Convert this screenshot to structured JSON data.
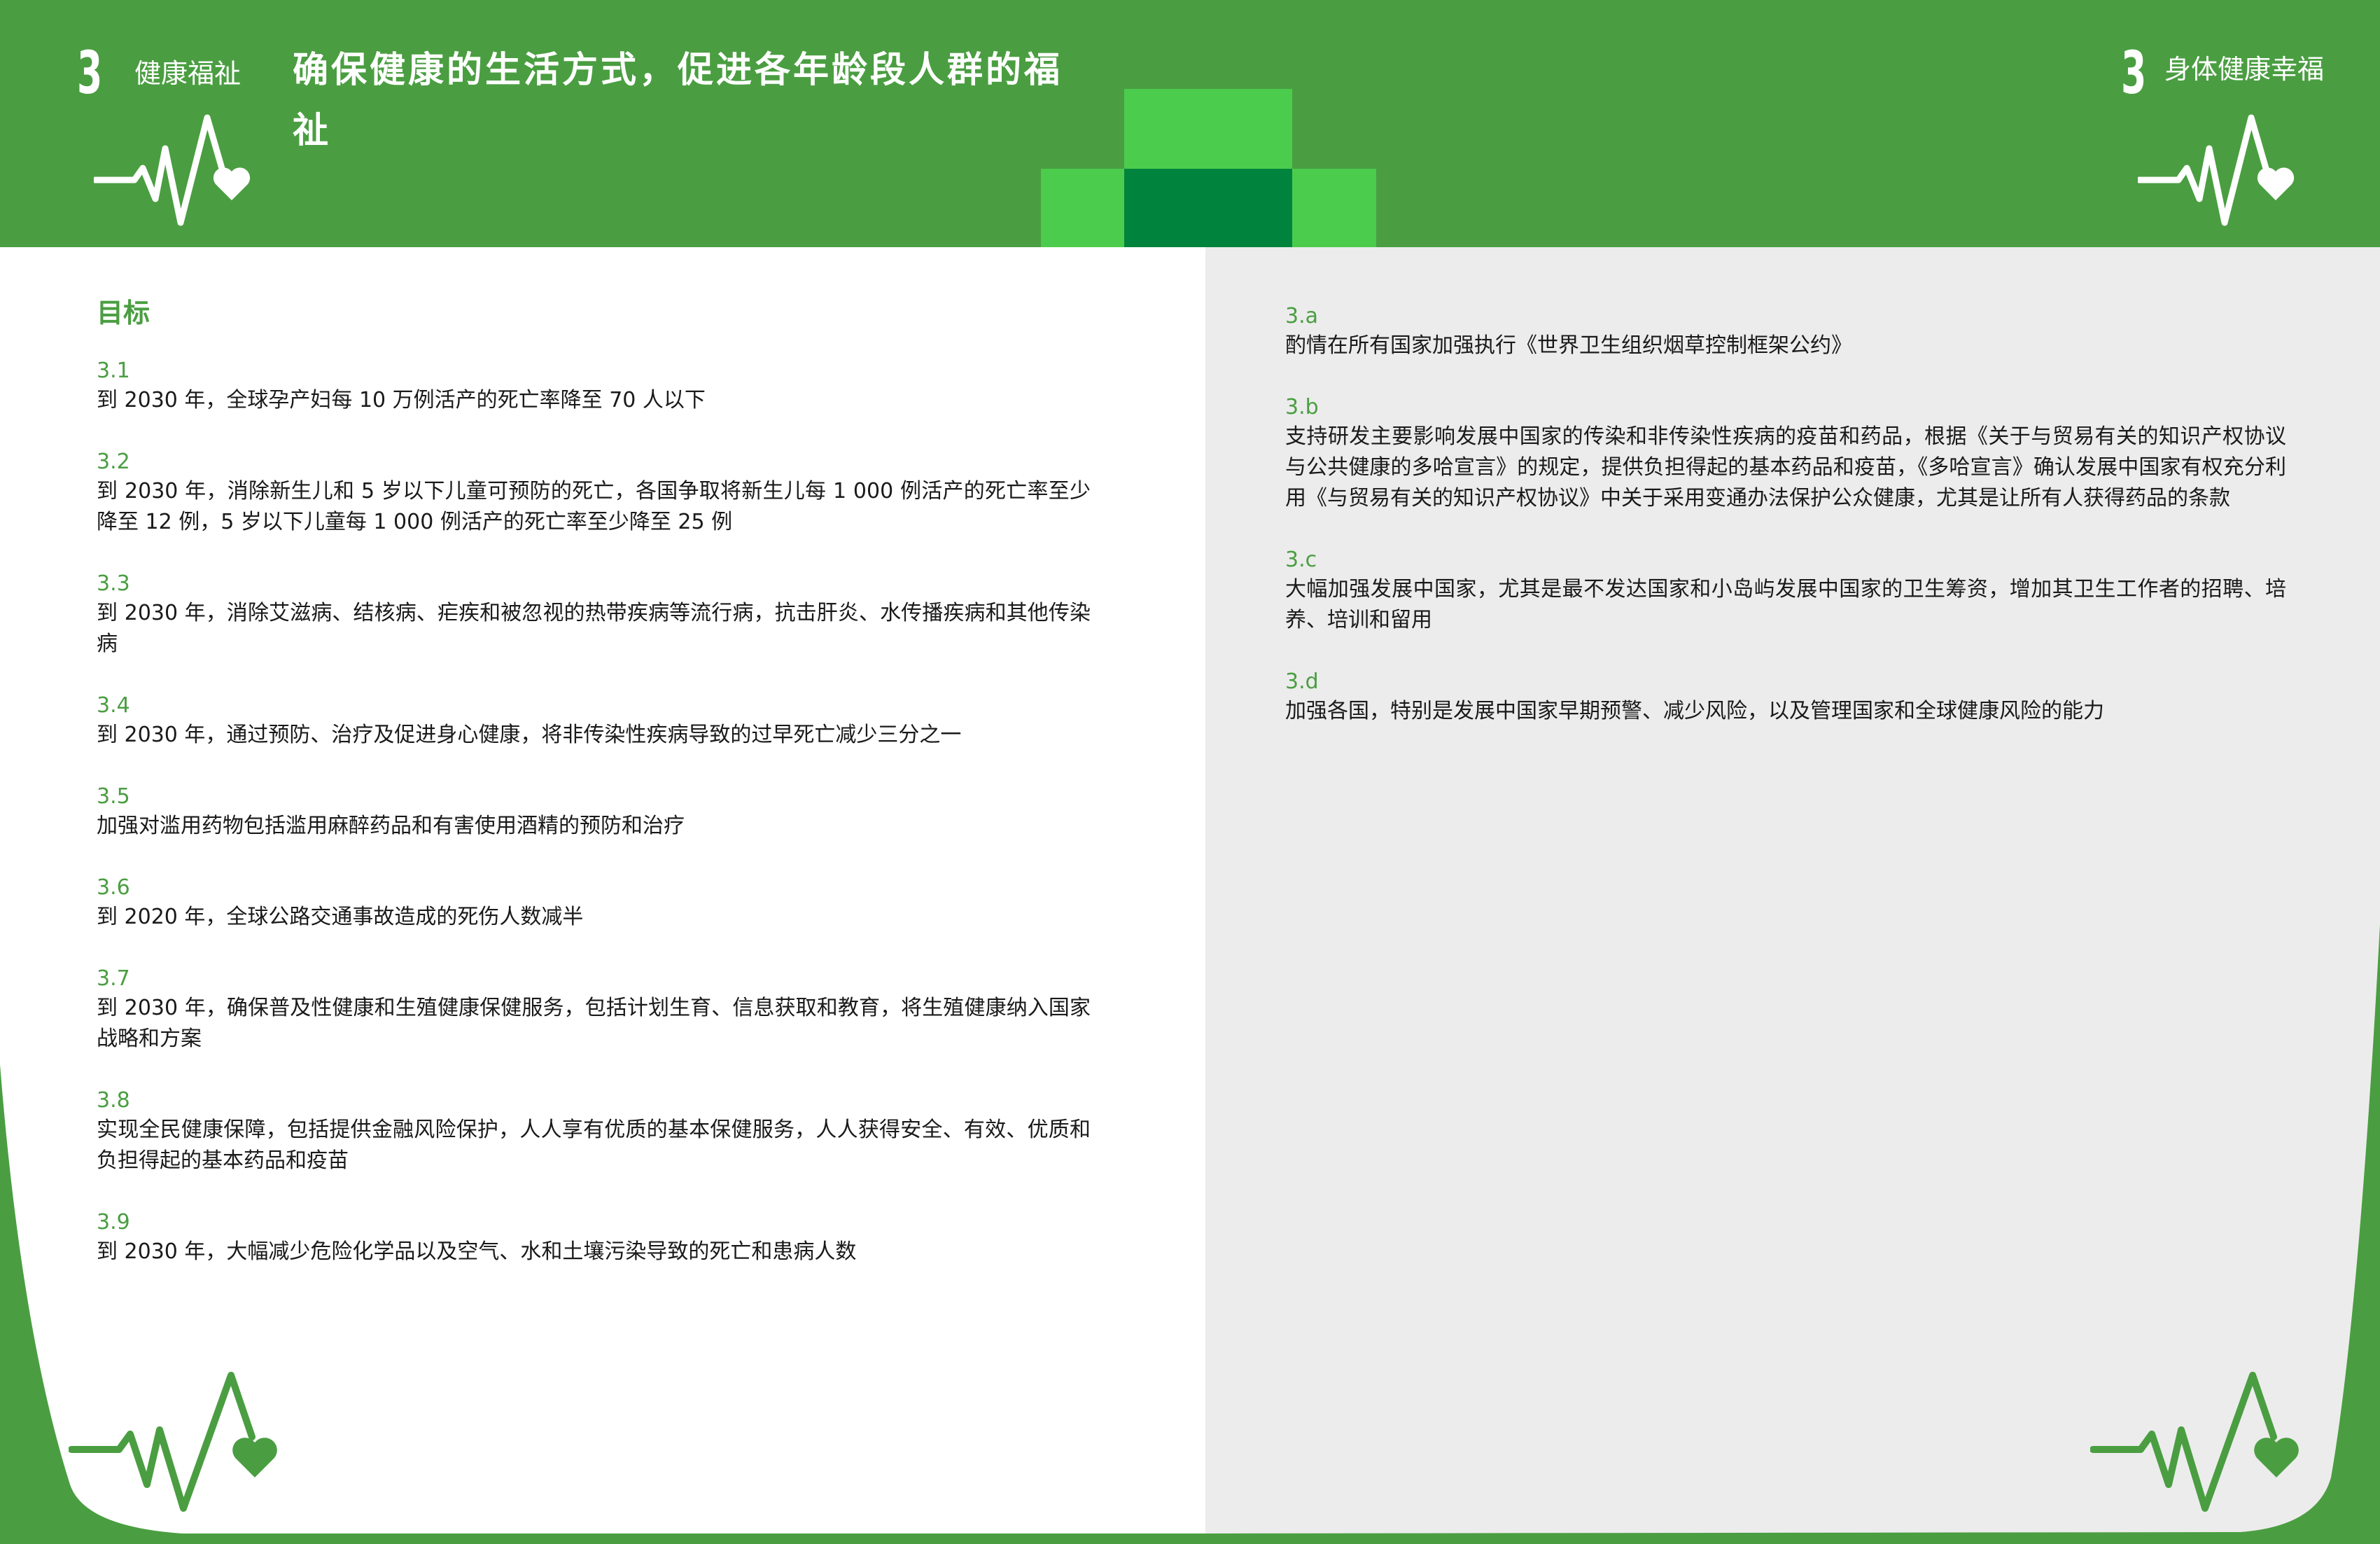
{
  "header": {
    "left_goal_number": "3",
    "left_goal_label": "健康福祉",
    "title": "确保健康的生活方式，促进各年龄段人群的福祉",
    "right_goal_number": "3",
    "right_goal_label": "身体健康幸福"
  },
  "left_column": {
    "heading": "目标",
    "targets": [
      {
        "code": "3.1",
        "text": "到 2030 年，全球孕产妇每 10 万例活产的死亡率降至 70 人以下"
      },
      {
        "code": "3.2",
        "text": "到 2030 年，消除新生儿和 5 岁以下儿童可预防的死亡，各国争取将新生儿每 1 000 例活产的死亡率至少降至 12 例，5 岁以下儿童每 1 000 例活产的死亡率至少降至 25 例"
      },
      {
        "code": "3.3",
        "text": "到 2030 年，消除艾滋病、结核病、疟疾和被忽视的热带疾病等流行病，抗击肝炎、水传播疾病和其他传染病"
      },
      {
        "code": "3.4",
        "text": "到 2030 年，通过预防、治疗及促进身心健康，将非传染性疾病导致的过早死亡减少三分之一"
      },
      {
        "code": "3.5",
        "text": "加强对滥用药物包括滥用麻醉药品和有害使用酒精的预防和治疗"
      },
      {
        "code": "3.6",
        "text": "到 2020 年，全球公路交通事故造成的死伤人数减半"
      },
      {
        "code": "3.7",
        "text": "到 2030 年，确保普及性健康和生殖健康保健服务，包括计划生育、信息获取和教育，将生殖健康纳入国家战略和方案"
      },
      {
        "code": "3.8",
        "text": "实现全民健康保障，包括提供金融风险保护，人人享有优质的基本保健服务，人人获得安全、有效、优质和负担得起的基本药品和疫苗"
      },
      {
        "code": "3.9",
        "text": "到 2030 年，大幅减少危险化学品以及空气、水和土壤污染导致的死亡和患病人数"
      }
    ]
  },
  "right_column": {
    "targets": [
      {
        "code": "3.a",
        "text": "酌情在所有国家加强执行《世界卫生组织烟草控制框架公约》"
      },
      {
        "code": "3.b",
        "text": "支持研发主要影响发展中国家的传染和非传染性疾病的疫苗和药品，根据《关于与贸易有关的知识产权协议与公共健康的多哈宣言》的规定，提供负担得起的基本药品和疫苗，《多哈宣言》确认发展中国家有权充分利用《与贸易有关的知识产权协议》中关于采用变通办法保护公众健康，尤其是让所有人获得药品的条款"
      },
      {
        "code": "3.c",
        "text": "大幅加强发展中国家，尤其是最不发达国家和小岛屿发展中国家的卫生筹资，增加其卫生工作者的招聘、培养、培训和留用"
      },
      {
        "code": "3.d",
        "text": "加强各国，特别是发展中国家早期预警、减少风险，以及管理国家和全球健康风险的能力"
      }
    ]
  },
  "icons": {
    "top_left": "heartbeat-heart-icon",
    "top_right": "heartbeat-heart-icon",
    "bottom_left": "heartbeat-heart-icon",
    "bottom_right": "heartbeat-heart-icon"
  },
  "colors": {
    "primary_green": "#4a9e41",
    "light_green": "#4ccc4c",
    "dark_green": "#00843d",
    "right_page_bg": "#ececec",
    "text": "#1a1a1a"
  }
}
